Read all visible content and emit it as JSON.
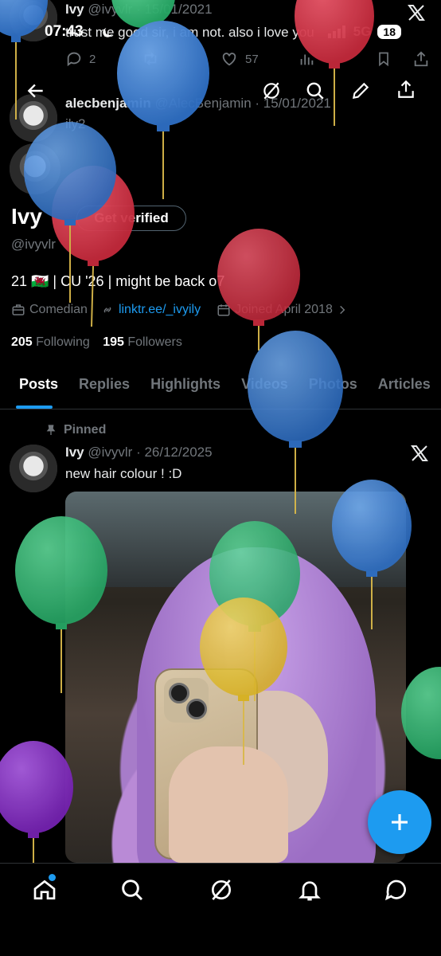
{
  "status_bar": {
    "time": "07:43",
    "network": "5G",
    "battery": "18"
  },
  "background_tweets": [
    {
      "name": "Ivy",
      "handle": "@ivyvlr",
      "date": "15/01/2021",
      "text": "trust me good sir, i am not. also i love you",
      "replies": "2",
      "likes": "57"
    },
    {
      "name": "alecbenjamin",
      "handle": "@AlecBenjamin",
      "date": "15/01/2021",
      "text": "ily2"
    }
  ],
  "profile": {
    "display_name": "Ivy",
    "verify_label": "Get verified",
    "handle": "@ivyvlr",
    "bio": "21 🏴󠁧󠁢󠁷󠁬󠁳󠁿 | CU '26 | might be back o7",
    "category": "Comedian",
    "link": "linktr.ee/_ivyily",
    "joined": "Joined April 2018",
    "following_count": "205",
    "following_label": "Following",
    "followers_count": "195",
    "followers_label": "Followers"
  },
  "tabs": [
    "Posts",
    "Replies",
    "Highlights",
    "Videos",
    "Photos",
    "Articles"
  ],
  "active_tab": "Posts",
  "pinned_post": {
    "pinned_label": "Pinned",
    "name": "Ivy",
    "handle": "@ivyvlr",
    "date": "26/12/2025",
    "text": "new hair colour ! :D"
  },
  "colors": {
    "accent": "#1d9bf0",
    "background": "#000000",
    "muted": "#71767b",
    "balloon_blue": "#3f86d8",
    "balloon_red": "#d9394b",
    "balloon_green": "#38c07b",
    "balloon_yellow": "#e8c535",
    "balloon_purple": "#8e32c9"
  },
  "icons": [
    "back-arrow-icon",
    "grok-icon",
    "search-icon",
    "edit-icon",
    "share-icon",
    "x-logo-icon",
    "pin-icon",
    "briefcase-icon",
    "link-icon",
    "calendar-icon",
    "home-icon",
    "explore-icon",
    "bell-icon",
    "chat-icon",
    "plus-icon"
  ]
}
